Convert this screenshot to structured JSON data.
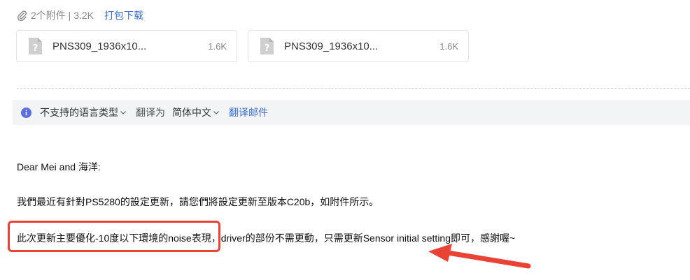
{
  "attachments": {
    "summary": "2个附件 | 3.2K",
    "download_label": "打包下载",
    "files": [
      {
        "name": "PNS309_1936x10...",
        "size": "1.6K"
      },
      {
        "name": "PNS309_1936x10...",
        "size": "1.6K"
      }
    ]
  },
  "translate_bar": {
    "source_lang": "不支持的语言类型",
    "translate_to_label": "翻译为",
    "target_lang": "简体中文",
    "translate_mail_link": "翻译邮件"
  },
  "mail": {
    "greeting": "Dear Mei and 海洋:",
    "line1": "我們最近有針對PS5280的設定更新，請您們將設定更新至版本C20b，如附件所示。",
    "line2": "此次更新主要優化-10度以下環境的noise表現，driver的部份不需更動，只需更新Sensor initial setting即可，感謝喔~"
  },
  "colors": {
    "accent": "#3a6fd8",
    "annotation": "#ea4335",
    "bar_bg": "#f3f4f6"
  }
}
